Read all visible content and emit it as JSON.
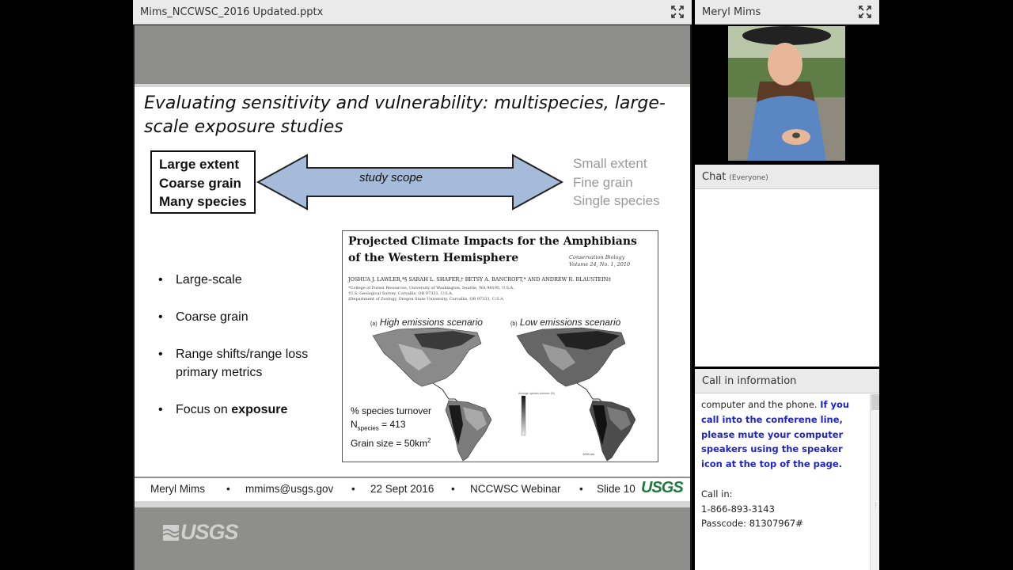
{
  "share_pod": {
    "title": "Mims_NCCWSC_2016 Updated.pptx",
    "fullscreen_icon": "expand-arrows-icon"
  },
  "slide": {
    "title": "Evaluating sensitivity and vulnerability: multispecies, large-scale exposure studies",
    "scope_left": [
      "Large extent",
      "Coarse grain",
      "Many species"
    ],
    "scope_right": [
      "Small extent",
      "Fine grain",
      "Single species"
    ],
    "arrow_label": "study scope",
    "bullets": [
      "Large-scale",
      "Coarse grain",
      "Range shifts/range loss primary metrics",
      "Focus on"
    ],
    "bullet_bold": "exposure",
    "paper": {
      "title": "Projected Climate Impacts for the Amphibians of the Western Hemisphere",
      "journal": "Conservation Biology",
      "volume": "Volume 24, No. 1, 2010",
      "authors": "JOSHUA J. LAWLER,*§ SARAH L. SHAFER,† BETSY A. BANCROFT,* AND ANDREW R. BLAUSTEIN‡",
      "affiliations": [
        "*College of Forest Resources, University of Washington, Seattle, WA 98195, U.S.A.",
        "†U.S. Geological Survey, Corvallis, OR 97331, U.S.A.",
        "‡Department of Zoology, Oregon State University, Corvallis, OR 97331, U.S.A."
      ],
      "scenario_high": "High emissions scenario",
      "scenario_high_prefix": "(a)",
      "scenario_low": "Low emissions scenario",
      "scenario_low_prefix": "(b)",
      "stat_turnover": "% species turnover",
      "stat_n_prefix": "N",
      "stat_n_sub": "species",
      "stat_n_value": "= 413",
      "stat_grain": "Grain size = 50km",
      "stat_grain_sup": "2",
      "legend_title": "Average species turnover (%)",
      "scale_label": "1000 km"
    },
    "footer": {
      "name": "Meryl Mims",
      "email": "mmims@usgs.gov",
      "date": "22 Sept 2016",
      "event": "NCCWSC Webinar",
      "slide_no": "Slide 10",
      "separator": "•",
      "logo": "USGS"
    },
    "watermark": "USGS"
  },
  "camera_pod": {
    "title": "Meryl Mims",
    "fullscreen_icon": "expand-arrows-icon"
  },
  "chat_pod": {
    "title": "Chat",
    "scope": "(Everyone)"
  },
  "callin_pod": {
    "title": "Call in information",
    "line1": "computer and the phone.",
    "notice": "If you call into the conferene line, please mute your computer speakers using the speaker icon at the top of the page.",
    "call_label": "Call in:",
    "phone": "1-866-893-3143",
    "passcode": "Passcode: 81307967#"
  },
  "colors": {
    "arrow_fill": "#a5bbd9",
    "usgs_green": "#217a3d",
    "notice_blue": "#2025c4",
    "slide_band": "#8e8f8d"
  }
}
